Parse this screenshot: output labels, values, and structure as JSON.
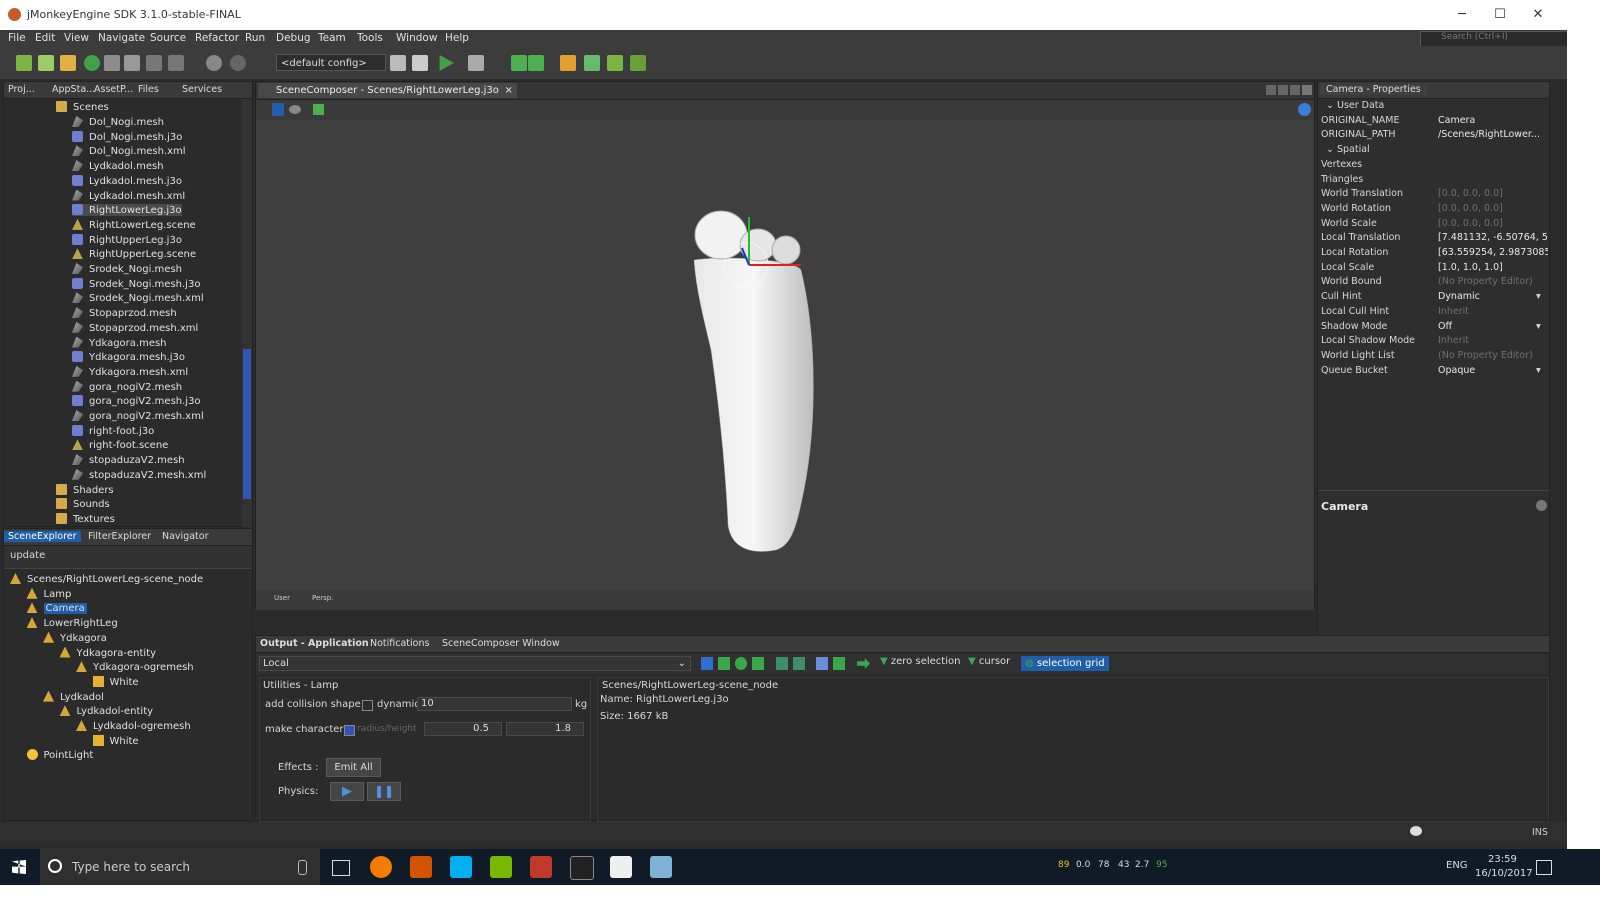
{
  "window": {
    "title": "jMonkeyEngine SDK 3.1.0-stable-FINAL",
    "minimize": "─",
    "maximize": "☐",
    "close": "✕"
  },
  "menu": [
    "File",
    "Edit",
    "View",
    "Navigate",
    "Source",
    "Refactor",
    "Run",
    "Debug",
    "Team",
    "Tools",
    "Window",
    "Help"
  ],
  "search": {
    "placeholder": "Search (Ctrl+I)"
  },
  "toolbar": {
    "config": "<default config>"
  },
  "projects": {
    "tabs": [
      "Proj...",
      "AppSta...",
      "AssetP...",
      "Files",
      "Services"
    ],
    "root": "Scenes",
    "files": [
      {
        "name": "Dol_Nogi.mesh",
        "type": "mesh"
      },
      {
        "name": "Dol_Nogi.mesh.j3o",
        "type": "j3o"
      },
      {
        "name": "Dol_Nogi.mesh.xml",
        "type": "mesh"
      },
      {
        "name": "Lydkadol.mesh",
        "type": "mesh"
      },
      {
        "name": "Lydkadol.mesh.j3o",
        "type": "j3o"
      },
      {
        "name": "Lydkadol.mesh.xml",
        "type": "mesh"
      },
      {
        "name": "RightLowerLeg.j3o",
        "type": "j3o",
        "selected": true
      },
      {
        "name": "RightLowerLeg.scene",
        "type": "scene"
      },
      {
        "name": "RightUpperLeg.j3o",
        "type": "j3o"
      },
      {
        "name": "RightUpperLeg.scene",
        "type": "scene"
      },
      {
        "name": "Srodek_Nogi.mesh",
        "type": "mesh"
      },
      {
        "name": "Srodek_Nogi.mesh.j3o",
        "type": "j3o"
      },
      {
        "name": "Srodek_Nogi.mesh.xml",
        "type": "mesh"
      },
      {
        "name": "Stopaprzod.mesh",
        "type": "mesh"
      },
      {
        "name": "Stopaprzod.mesh.xml",
        "type": "mesh"
      },
      {
        "name": "Ydkagora.mesh",
        "type": "mesh"
      },
      {
        "name": "Ydkagora.mesh.j3o",
        "type": "j3o"
      },
      {
        "name": "Ydkagora.mesh.xml",
        "type": "mesh"
      },
      {
        "name": "gora_nogiV2.mesh",
        "type": "mesh"
      },
      {
        "name": "gora_nogiV2.mesh.j3o",
        "type": "j3o"
      },
      {
        "name": "gora_nogiV2.mesh.xml",
        "type": "mesh"
      },
      {
        "name": "right-foot.j3o",
        "type": "j3o"
      },
      {
        "name": "right-foot.scene",
        "type": "scene"
      },
      {
        "name": "stopaduzaV2.mesh",
        "type": "mesh"
      },
      {
        "name": "stopaduzaV2.mesh.xml",
        "type": "mesh"
      }
    ],
    "folders": [
      "Shaders",
      "Sounds",
      "Textures"
    ]
  },
  "explorer": {
    "tabs": [
      "SceneExplorer",
      "FilterExplorer",
      "Navigator"
    ],
    "update": "update",
    "nodes": [
      {
        "label": "Scenes/RightLowerLeg-scene_node",
        "depth": 0,
        "type": "node"
      },
      {
        "label": "Lamp",
        "depth": 1,
        "type": "node"
      },
      {
        "label": "Camera",
        "depth": 1,
        "type": "node",
        "selected": true
      },
      {
        "label": "LowerRightLeg",
        "depth": 1,
        "type": "node"
      },
      {
        "label": "Ydkagora",
        "depth": 2,
        "type": "node"
      },
      {
        "label": "Ydkagora-entity",
        "depth": 3,
        "type": "node"
      },
      {
        "label": "Ydkagora-ogremesh",
        "depth": 4,
        "type": "node"
      },
      {
        "label": "White",
        "depth": 5,
        "type": "geom"
      },
      {
        "label": "Lydkadol",
        "depth": 2,
        "type": "node"
      },
      {
        "label": "Lydkadol-entity",
        "depth": 3,
        "type": "node"
      },
      {
        "label": "Lydkadol-ogremesh",
        "depth": 4,
        "type": "node"
      },
      {
        "label": "White",
        "depth": 5,
        "type": "geom"
      },
      {
        "label": "PointLight",
        "depth": 1,
        "type": "light"
      }
    ]
  },
  "editor": {
    "tab": "SceneComposer - Scenes/RightLowerLeg.j3o",
    "bottom_user": "User",
    "bottom_persp": "Persp."
  },
  "properties": {
    "title": "Camera - Properties",
    "sections": {
      "user_data": "User Data",
      "spatial": "Spatial"
    },
    "user_data": [
      {
        "k": "ORIGINAL_NAME",
        "v": "Camera"
      },
      {
        "k": "ORIGINAL_PATH",
        "v": "/Scenes/RightLower..."
      }
    ],
    "spatial": [
      {
        "k": "Vertexes",
        "v": "",
        "dim": false
      },
      {
        "k": "Triangles",
        "v": "",
        "dim": false
      },
      {
        "k": "World Translation",
        "v": "[0.0, 0.0, 0.0]",
        "dim": true
      },
      {
        "k": "World Rotation",
        "v": "[0.0, 0.0, 0.0]",
        "dim": true
      },
      {
        "k": "World Scale",
        "v": "[0.0, 0.0, 0.0]",
        "dim": true
      },
      {
        "k": "Local Translation",
        "v": "[7.481132, -6.50764, 5....",
        "dim": false
      },
      {
        "k": "Local Rotation",
        "v": "[63.559254, 2.9873085...",
        "dim": false
      },
      {
        "k": "Local Scale",
        "v": "[1.0, 1.0, 1.0]",
        "dim": false
      },
      {
        "k": "World Bound",
        "v": "(No Property Editor)",
        "dim": true
      },
      {
        "k": "Cull Hint",
        "v": "Dynamic",
        "dim": false,
        "dropdown": true
      },
      {
        "k": "Local Cull Hint",
        "v": "Inherit",
        "dim": true
      },
      {
        "k": "Shadow Mode",
        "v": "Off",
        "dim": false,
        "dropdown": true
      },
      {
        "k": "Local Shadow Mode",
        "v": "Inherit",
        "dim": true
      },
      {
        "k": "World Light List",
        "v": "(No Property Editor)",
        "dim": true
      },
      {
        "k": "Queue Bucket",
        "v": "Opaque",
        "dim": false,
        "dropdown": true
      }
    ],
    "footer": "Camera"
  },
  "output": {
    "tabs": [
      {
        "label": "Output - Application",
        "active": true
      },
      {
        "label": "Notifications"
      },
      {
        "label": "SceneComposer Window"
      }
    ],
    "local": "Local",
    "actions": {
      "zero_selection": "zero selection",
      "cursor": "cursor",
      "selection_grid": "selection grid"
    },
    "utilities": {
      "title": "Utilities - Lamp",
      "add_collision": "add collision shape",
      "dynamic_label": "dynamic:",
      "dynamic_value": "10",
      "unit": "kg",
      "make_character": "make character",
      "radius_height": "radius/height",
      "radius": "0.5",
      "height": "1.8",
      "effects": "Effects :",
      "emit_all": "Emit All",
      "physics": "Physics:"
    },
    "info": {
      "node": "Scenes/RightLowerLeg-scene_node",
      "name": "Name: RightLowerLeg.j3o",
      "size": "Size: 1667 kB"
    }
  },
  "statusbar": {
    "ins": "INS"
  },
  "taskbar": {
    "search": "Type here to search",
    "tray_values": [
      "89",
      "0.0",
      "78",
      "43",
      "2.7",
      "95"
    ],
    "lang": "ENG",
    "time": "23:59",
    "date": "16/10/2017"
  },
  "colors": {
    "accent": "#1f5ea8",
    "panel": "#2b2b2b",
    "viewport": "#3f3f3f"
  }
}
